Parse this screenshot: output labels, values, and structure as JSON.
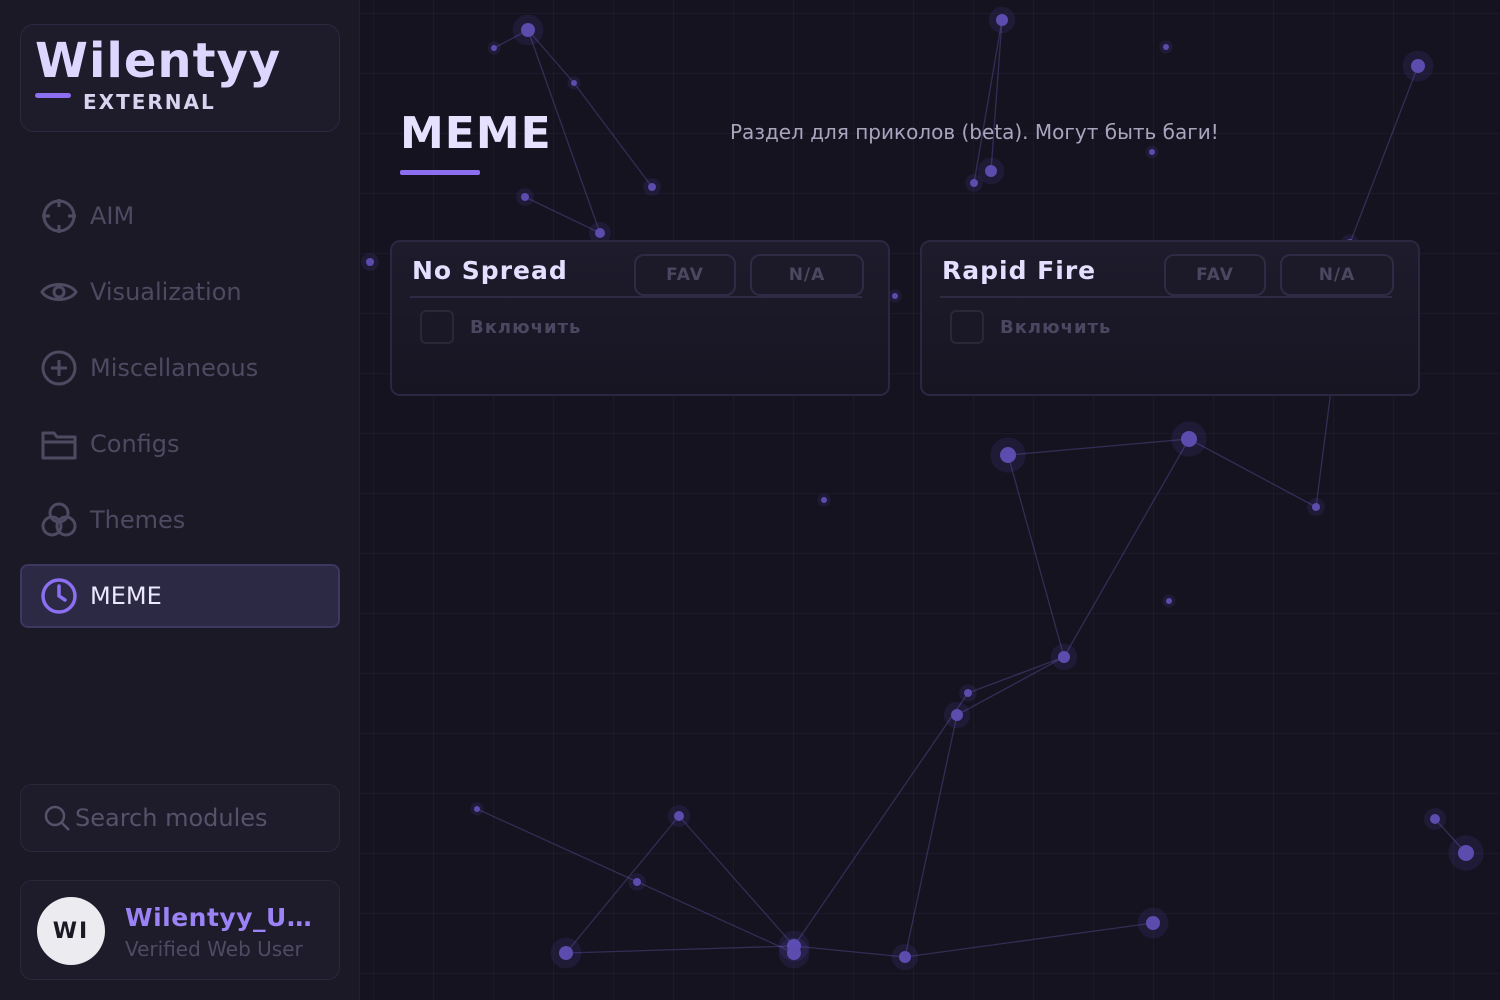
{
  "colors": {
    "accent": "#8b6ff0",
    "sidebar_bg": "#1b1926",
    "main_bg": "#15131f",
    "active_item_bg": "#2c2944",
    "muted_text": "#4d4a62"
  },
  "sidebar": {
    "logo": {
      "title": "Wilentyy",
      "subtitle": "EXTERNAL"
    },
    "items": [
      {
        "label": "AIM",
        "icon": "crosshair-icon",
        "active": false
      },
      {
        "label": "Visualization",
        "icon": "eye-icon",
        "active": false
      },
      {
        "label": "Miscellaneous",
        "icon": "plus-circle-icon",
        "active": false
      },
      {
        "label": "Configs",
        "icon": "folder-icon",
        "active": false
      },
      {
        "label": "Themes",
        "icon": "palette-circles-icon",
        "active": false
      },
      {
        "label": "MEME",
        "icon": "clock-icon",
        "active": true
      }
    ],
    "search": {
      "placeholder": "Search modules",
      "icon": "search-icon"
    },
    "user": {
      "initials": "WI",
      "name": "Wilentyy_U…",
      "role": "Verified Web User"
    }
  },
  "main": {
    "title": "MEME",
    "description": "Раздел для приколов (beta). Могут быть баги!",
    "cards": [
      {
        "title": "No Spread",
        "fav_label": "FAV",
        "status_label": "N/A",
        "toggle_label": "Включить",
        "enabled": false
      },
      {
        "title": "Rapid Fire",
        "fav_label": "FAV",
        "status_label": "N/A",
        "toggle_label": "Включить",
        "enabled": false
      }
    ]
  }
}
